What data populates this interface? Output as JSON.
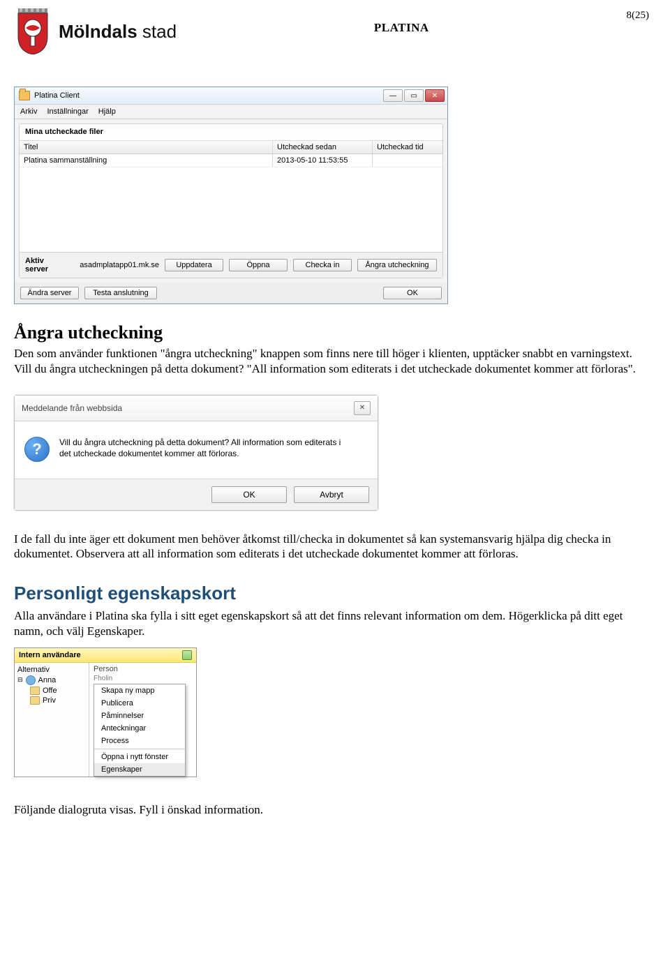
{
  "header": {
    "logo_text_1": "Mölndals",
    "logo_text_2": " stad",
    "center_title": "PLATINA",
    "page_num": "8(25)"
  },
  "app": {
    "title": "Platina Client",
    "menu": [
      "Arkiv",
      "Inställningar",
      "Hjälp"
    ],
    "panel_title": "Mina utcheckade filer",
    "columns": [
      "Titel",
      "Utcheckad sedan",
      "Utcheckad tid"
    ],
    "row": {
      "title": "Platina sammanställning",
      "date": "2013-05-10 11:53:55",
      "time": ""
    },
    "server_label": "Aktiv server",
    "server_value": "asadmplatapp01.mk.se",
    "buttons": {
      "uppdatera": "Uppdatera",
      "oppna": "Öppna",
      "checka_in": "Checka in",
      "angra": "Ångra utcheckning"
    },
    "footer": {
      "andra": "Ändra server",
      "testa": "Testa anslutning",
      "ok": "OK"
    }
  },
  "sec1": {
    "heading": "Ångra utcheckning",
    "p1": "Den som använder funktionen \"ångra utcheckning\" knappen som finns nere till höger i klienten, upptäcker snabbt en varningstext. Vill du ångra utcheckningen på detta dokument? \"All information som editerats i det utcheckade dokumentet kommer att förloras\"."
  },
  "dialog": {
    "title": "Meddelande från webbsida",
    "msg": "Vill du ångra utcheckning på detta dokument? All information som editerats i det utcheckade dokumentet kommer att förloras.",
    "ok": "OK",
    "cancel": "Avbryt"
  },
  "sec2": {
    "p1": "I de fall du inte äger ett dokument men behöver åtkomst till/checka in dokumentet så kan systemansvarig hjälpa dig checka in dokumentet. Observera att all information som editerats i det utcheckade dokumentet kommer att förloras."
  },
  "sec3": {
    "heading": "Personligt egenskapskort",
    "p1": "Alla användare i Platina ska fylla i sitt eget egenskapskort så att det finns relevant information om dem. Högerklicka på ditt eget namn, och välj Egenskaper."
  },
  "ctx": {
    "top": "Intern användare",
    "left_alt": "Alternativ",
    "user": "Anna",
    "user_last_partial": "Fholin",
    "folders": [
      "Offe",
      "Priv"
    ],
    "right_head": "Person",
    "menu": [
      "Skapa ny mapp",
      "Publicera",
      "Påminnelser",
      "Anteckningar",
      "Process",
      "Öppna i nytt fönster",
      "Egenskaper"
    ]
  },
  "closing": "Följande dialogruta visas. Fyll i önskad information."
}
